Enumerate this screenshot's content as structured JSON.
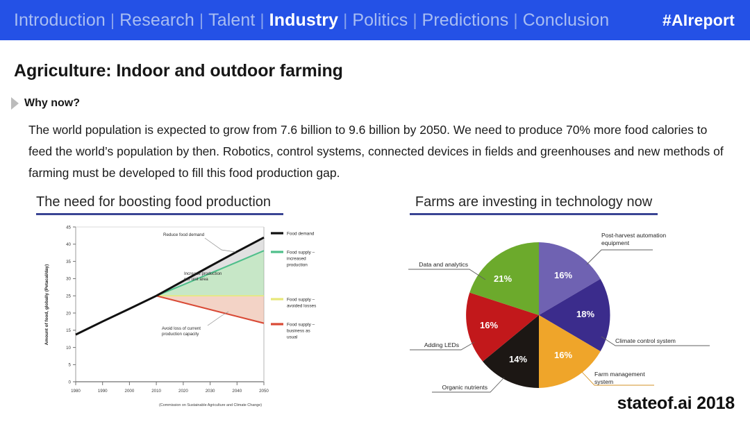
{
  "header": {
    "nav_items": [
      {
        "label": "Introduction",
        "active": false
      },
      {
        "label": "Research",
        "active": false
      },
      {
        "label": "Talent",
        "active": false
      },
      {
        "label": "Industry",
        "active": true
      },
      {
        "label": "Politics",
        "active": false
      },
      {
        "label": "Predictions",
        "active": false
      },
      {
        "label": "Conclusion",
        "active": false
      }
    ],
    "separator": "|",
    "hashtag": "#AIreport",
    "background_color": "#2451E6",
    "active_color": "#FFFFFF",
    "inactive_color": "#A8BDF2"
  },
  "slide": {
    "title": "Agriculture: Indoor and outdoor farming",
    "why_label": "Why now?",
    "body": "The world population is expected to grow from 7.6 billion to 9.6 billion by 2050. We need to produce 70% more food calories to feed the world’s population by then. Robotics, control systems, connected devices in fields and greenhouses and new methods of farming must be developed to fill this food production gap.",
    "branding": "stateof.ai 2018",
    "accent_underline_color": "#3A4493"
  },
  "left_panel": {
    "heading": "The need for boosting food production"
  },
  "right_panel": {
    "heading": "Farms are investing in technology now"
  },
  "chart_data": [
    {
      "type": "line",
      "title": "The need for boosting food production",
      "xlabel": "",
      "ylabel": "Amount of food, globally (Petacal/day)",
      "source_note": "(Commission on Sustainable Agriculture and Climate Change)",
      "xlim": [
        1980,
        2050
      ],
      "ylim": [
        0,
        45
      ],
      "xticks": [
        1980,
        1990,
        2000,
        2010,
        2020,
        2030,
        2040,
        2050
      ],
      "yticks": [
        0,
        5,
        10,
        15,
        20,
        25,
        30,
        35,
        40,
        45
      ],
      "grid": false,
      "legend_position": "right",
      "x": [
        1980,
        1990,
        2000,
        2010,
        2020,
        2030,
        2040,
        2050
      ],
      "series": [
        {
          "name": "Food demand",
          "color": "#111111",
          "values": [
            13.7,
            17.5,
            21.2,
            25.0,
            29.3,
            33.6,
            37.8,
            42.0
          ]
        },
        {
          "name": "Food supply – increased production",
          "color": "#4FBF8B",
          "values": [
            13.7,
            17.5,
            21.2,
            25.0,
            28.2,
            31.5,
            34.8,
            38.1
          ]
        },
        {
          "name": "Food supply – avoided losses",
          "color": "#E8E87A",
          "values": [
            13.7,
            17.5,
            21.2,
            25.0,
            25.0,
            25.0,
            25.0,
            25.0
          ]
        },
        {
          "name": "Food supply – business as usual",
          "color": "#D94A36",
          "values": [
            13.7,
            17.5,
            21.2,
            25.0,
            23.0,
            21.0,
            19.0,
            17.0
          ]
        }
      ],
      "annotations": [
        {
          "text": "Reduce food demand",
          "lines": [
            "Reduce food demand"
          ]
        },
        {
          "text": "Increase production per unit area",
          "lines": [
            "Increase production",
            "per unit area"
          ]
        },
        {
          "text": "Avoid loss of current production capacity",
          "lines": [
            "Avoid loss of current",
            "production capacity"
          ]
        }
      ]
    },
    {
      "type": "pie",
      "title": "Farms are investing in technology now",
      "legend_position": "callout-labels",
      "categories": [
        "Post-harvest automation equipment",
        "Climate control system",
        "Farm management system",
        "Organic nutrients",
        "Adding LEDs",
        "Data and analytics"
      ],
      "values": [
        16,
        18,
        16,
        14,
        16,
        21
      ],
      "value_labels": [
        "16%",
        "18%",
        "16%",
        "14%",
        "16%",
        "21%"
      ],
      "colors": [
        "#6F62B2",
        "#3B2C8C",
        "#EFA52A",
        "#1C1714",
        "#C2181B",
        "#6CAA2C"
      ],
      "label_callouts": [
        {
          "label": "Post-harvest automation equipment",
          "lines": [
            "Post-harvest automation",
            "equipment"
          ],
          "side": "right"
        },
        {
          "label": "Climate control system",
          "lines": [
            "Climate control system"
          ],
          "side": "right"
        },
        {
          "label": "Farm management system",
          "lines": [
            "Farm management",
            "system"
          ],
          "side": "right"
        },
        {
          "label": "Organic nutrients",
          "lines": [
            "Organic nutrients"
          ],
          "side": "left"
        },
        {
          "label": "Adding LEDs",
          "lines": [
            "Adding LEDs"
          ],
          "side": "left"
        },
        {
          "label": "Data and analytics",
          "lines": [
            "Data and analytics"
          ],
          "side": "left"
        }
      ]
    }
  ]
}
